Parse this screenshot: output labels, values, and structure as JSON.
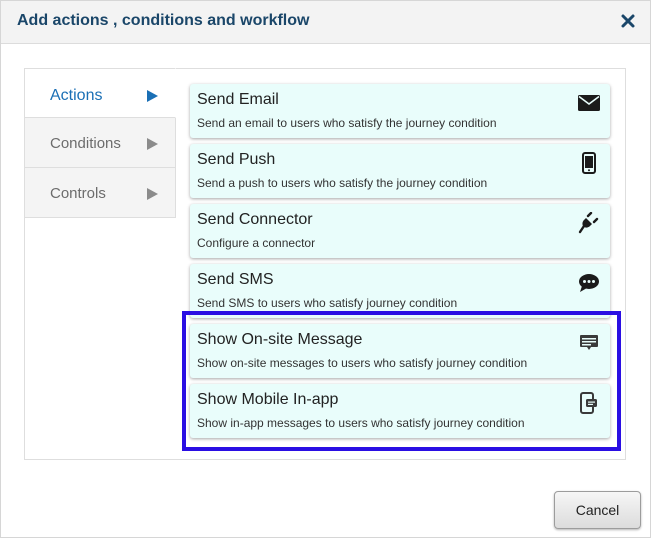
{
  "dialog": {
    "title": "Add actions , conditions and workflow",
    "close_icon": "close-icon",
    "cancel_label": "Cancel"
  },
  "tabs": [
    {
      "label": "Actions",
      "active": true
    },
    {
      "label": "Conditions",
      "active": false
    },
    {
      "label": "Controls",
      "active": false
    }
  ],
  "actions": [
    {
      "title": "Send Email",
      "description": "Send an email to users who satisfy the journey condition",
      "icon": "envelope-icon"
    },
    {
      "title": "Send Push",
      "description": "Send a push to users who satisfy the journey condition",
      "icon": "mobile-phone-icon"
    },
    {
      "title": "Send Connector",
      "description": "Configure a connector",
      "icon": "plug-icon"
    },
    {
      "title": "Send SMS",
      "description": "Send SMS to users who satisfy journey condition",
      "icon": "chat-bubble-icon"
    },
    {
      "title": "Show On-site Message",
      "description": "Show on-site messages to users who satisfy journey condition",
      "icon": "onsite-message-icon"
    },
    {
      "title": "Show Mobile In-app",
      "description": "Show in-app messages to users who satisfy journey condition",
      "icon": "mobile-inapp-icon"
    }
  ],
  "colors": {
    "title": "#1a4669",
    "active_tab": "#1a6fb5",
    "card_bg": "#e9fdfb",
    "highlight": "#2a0ee3"
  }
}
